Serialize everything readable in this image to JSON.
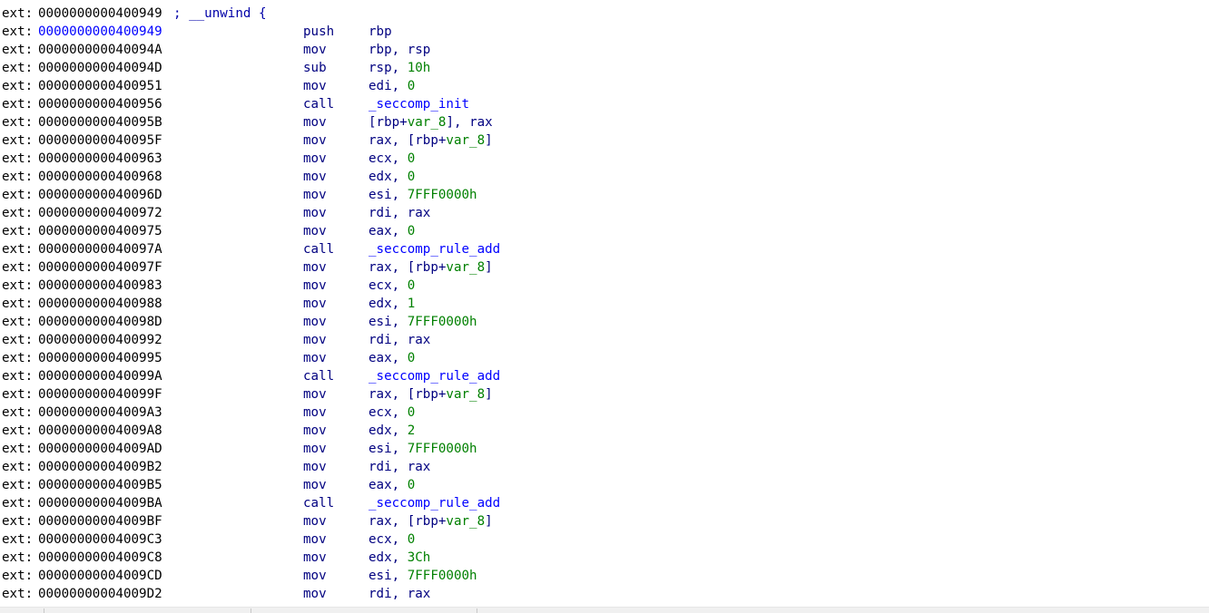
{
  "segment": "ext:",
  "header": {
    "address": "0000000000400949",
    "comment": "; __unwind {"
  },
  "lines": [
    {
      "addr": "0000000000400949",
      "mnem": "push",
      "ops": [
        {
          "t": "reg",
          "v": "rbp"
        }
      ],
      "current": true
    },
    {
      "addr": "000000000040094A",
      "mnem": "mov",
      "ops": [
        {
          "t": "reg",
          "v": "rbp"
        },
        {
          "t": "plain",
          "v": ", "
        },
        {
          "t": "reg",
          "v": "rsp"
        }
      ]
    },
    {
      "addr": "000000000040094D",
      "mnem": "sub",
      "ops": [
        {
          "t": "reg",
          "v": "rsp"
        },
        {
          "t": "plain",
          "v": ", "
        },
        {
          "t": "num",
          "v": "10h"
        }
      ]
    },
    {
      "addr": "0000000000400951",
      "mnem": "mov",
      "ops": [
        {
          "t": "reg",
          "v": "edi"
        },
        {
          "t": "plain",
          "v": ", "
        },
        {
          "t": "num",
          "v": "0"
        }
      ]
    },
    {
      "addr": "0000000000400956",
      "mnem": "call",
      "ops": [
        {
          "t": "func",
          "v": "_seccomp_init"
        }
      ]
    },
    {
      "addr": "000000000040095B",
      "mnem": "mov",
      "ops": [
        {
          "t": "plain",
          "v": "[rbp+"
        },
        {
          "t": "var",
          "v": "var_8"
        },
        {
          "t": "plain",
          "v": "], "
        },
        {
          "t": "reg",
          "v": "rax"
        }
      ]
    },
    {
      "addr": "000000000040095F",
      "mnem": "mov",
      "ops": [
        {
          "t": "reg",
          "v": "rax"
        },
        {
          "t": "plain",
          "v": ", [rbp+"
        },
        {
          "t": "var",
          "v": "var_8"
        },
        {
          "t": "plain",
          "v": "]"
        }
      ]
    },
    {
      "addr": "0000000000400963",
      "mnem": "mov",
      "ops": [
        {
          "t": "reg",
          "v": "ecx"
        },
        {
          "t": "plain",
          "v": ", "
        },
        {
          "t": "num",
          "v": "0"
        }
      ]
    },
    {
      "addr": "0000000000400968",
      "mnem": "mov",
      "ops": [
        {
          "t": "reg",
          "v": "edx"
        },
        {
          "t": "plain",
          "v": ", "
        },
        {
          "t": "num",
          "v": "0"
        }
      ]
    },
    {
      "addr": "000000000040096D",
      "mnem": "mov",
      "ops": [
        {
          "t": "reg",
          "v": "esi"
        },
        {
          "t": "plain",
          "v": ", "
        },
        {
          "t": "num",
          "v": "7FFF0000h"
        }
      ]
    },
    {
      "addr": "0000000000400972",
      "mnem": "mov",
      "ops": [
        {
          "t": "reg",
          "v": "rdi"
        },
        {
          "t": "plain",
          "v": ", "
        },
        {
          "t": "reg",
          "v": "rax"
        }
      ]
    },
    {
      "addr": "0000000000400975",
      "mnem": "mov",
      "ops": [
        {
          "t": "reg",
          "v": "eax"
        },
        {
          "t": "plain",
          "v": ", "
        },
        {
          "t": "num",
          "v": "0"
        }
      ]
    },
    {
      "addr": "000000000040097A",
      "mnem": "call",
      "ops": [
        {
          "t": "func",
          "v": "_seccomp_rule_add"
        }
      ]
    },
    {
      "addr": "000000000040097F",
      "mnem": "mov",
      "ops": [
        {
          "t": "reg",
          "v": "rax"
        },
        {
          "t": "plain",
          "v": ", [rbp+"
        },
        {
          "t": "var",
          "v": "var_8"
        },
        {
          "t": "plain",
          "v": "]"
        }
      ]
    },
    {
      "addr": "0000000000400983",
      "mnem": "mov",
      "ops": [
        {
          "t": "reg",
          "v": "ecx"
        },
        {
          "t": "plain",
          "v": ", "
        },
        {
          "t": "num",
          "v": "0"
        }
      ]
    },
    {
      "addr": "0000000000400988",
      "mnem": "mov",
      "ops": [
        {
          "t": "reg",
          "v": "edx"
        },
        {
          "t": "plain",
          "v": ", "
        },
        {
          "t": "num",
          "v": "1"
        }
      ]
    },
    {
      "addr": "000000000040098D",
      "mnem": "mov",
      "ops": [
        {
          "t": "reg",
          "v": "esi"
        },
        {
          "t": "plain",
          "v": ", "
        },
        {
          "t": "num",
          "v": "7FFF0000h"
        }
      ]
    },
    {
      "addr": "0000000000400992",
      "mnem": "mov",
      "ops": [
        {
          "t": "reg",
          "v": "rdi"
        },
        {
          "t": "plain",
          "v": ", "
        },
        {
          "t": "reg",
          "v": "rax"
        }
      ]
    },
    {
      "addr": "0000000000400995",
      "mnem": "mov",
      "ops": [
        {
          "t": "reg",
          "v": "eax"
        },
        {
          "t": "plain",
          "v": ", "
        },
        {
          "t": "num",
          "v": "0"
        }
      ]
    },
    {
      "addr": "000000000040099A",
      "mnem": "call",
      "ops": [
        {
          "t": "func",
          "v": "_seccomp_rule_add"
        }
      ]
    },
    {
      "addr": "000000000040099F",
      "mnem": "mov",
      "ops": [
        {
          "t": "reg",
          "v": "rax"
        },
        {
          "t": "plain",
          "v": ", [rbp+"
        },
        {
          "t": "var",
          "v": "var_8"
        },
        {
          "t": "plain",
          "v": "]"
        }
      ]
    },
    {
      "addr": "00000000004009A3",
      "mnem": "mov",
      "ops": [
        {
          "t": "reg",
          "v": "ecx"
        },
        {
          "t": "plain",
          "v": ", "
        },
        {
          "t": "num",
          "v": "0"
        }
      ]
    },
    {
      "addr": "00000000004009A8",
      "mnem": "mov",
      "ops": [
        {
          "t": "reg",
          "v": "edx"
        },
        {
          "t": "plain",
          "v": ", "
        },
        {
          "t": "num",
          "v": "2"
        }
      ]
    },
    {
      "addr": "00000000004009AD",
      "mnem": "mov",
      "ops": [
        {
          "t": "reg",
          "v": "esi"
        },
        {
          "t": "plain",
          "v": ", "
        },
        {
          "t": "num",
          "v": "7FFF0000h"
        }
      ]
    },
    {
      "addr": "00000000004009B2",
      "mnem": "mov",
      "ops": [
        {
          "t": "reg",
          "v": "rdi"
        },
        {
          "t": "plain",
          "v": ", "
        },
        {
          "t": "reg",
          "v": "rax"
        }
      ]
    },
    {
      "addr": "00000000004009B5",
      "mnem": "mov",
      "ops": [
        {
          "t": "reg",
          "v": "eax"
        },
        {
          "t": "plain",
          "v": ", "
        },
        {
          "t": "num",
          "v": "0"
        }
      ]
    },
    {
      "addr": "00000000004009BA",
      "mnem": "call",
      "ops": [
        {
          "t": "func",
          "v": "_seccomp_rule_add"
        }
      ]
    },
    {
      "addr": "00000000004009BF",
      "mnem": "mov",
      "ops": [
        {
          "t": "reg",
          "v": "rax"
        },
        {
          "t": "plain",
          "v": ", [rbp+"
        },
        {
          "t": "var",
          "v": "var_8"
        },
        {
          "t": "plain",
          "v": "]"
        }
      ]
    },
    {
      "addr": "00000000004009C3",
      "mnem": "mov",
      "ops": [
        {
          "t": "reg",
          "v": "ecx"
        },
        {
          "t": "plain",
          "v": ", "
        },
        {
          "t": "num",
          "v": "0"
        }
      ]
    },
    {
      "addr": "00000000004009C8",
      "mnem": "mov",
      "ops": [
        {
          "t": "reg",
          "v": "edx"
        },
        {
          "t": "plain",
          "v": ", "
        },
        {
          "t": "num",
          "v": "3Ch"
        }
      ]
    },
    {
      "addr": "00000000004009CD",
      "mnem": "mov",
      "ops": [
        {
          "t": "reg",
          "v": "esi"
        },
        {
          "t": "plain",
          "v": ", "
        },
        {
          "t": "num",
          "v": "7FFF0000h"
        }
      ]
    },
    {
      "addr": "00000000004009D2",
      "mnem": "mov",
      "ops": [
        {
          "t": "reg",
          "v": "rdi"
        },
        {
          "t": "plain",
          "v": ", "
        },
        {
          "t": "reg",
          "v": "rax"
        }
      ]
    }
  ],
  "colors": {
    "current_address": "#0000ff",
    "mnemonic": "#000080",
    "register": "#000080",
    "number": "#008000",
    "variable": "#008000",
    "function": "#0000ff",
    "comment": "#0000a8"
  }
}
